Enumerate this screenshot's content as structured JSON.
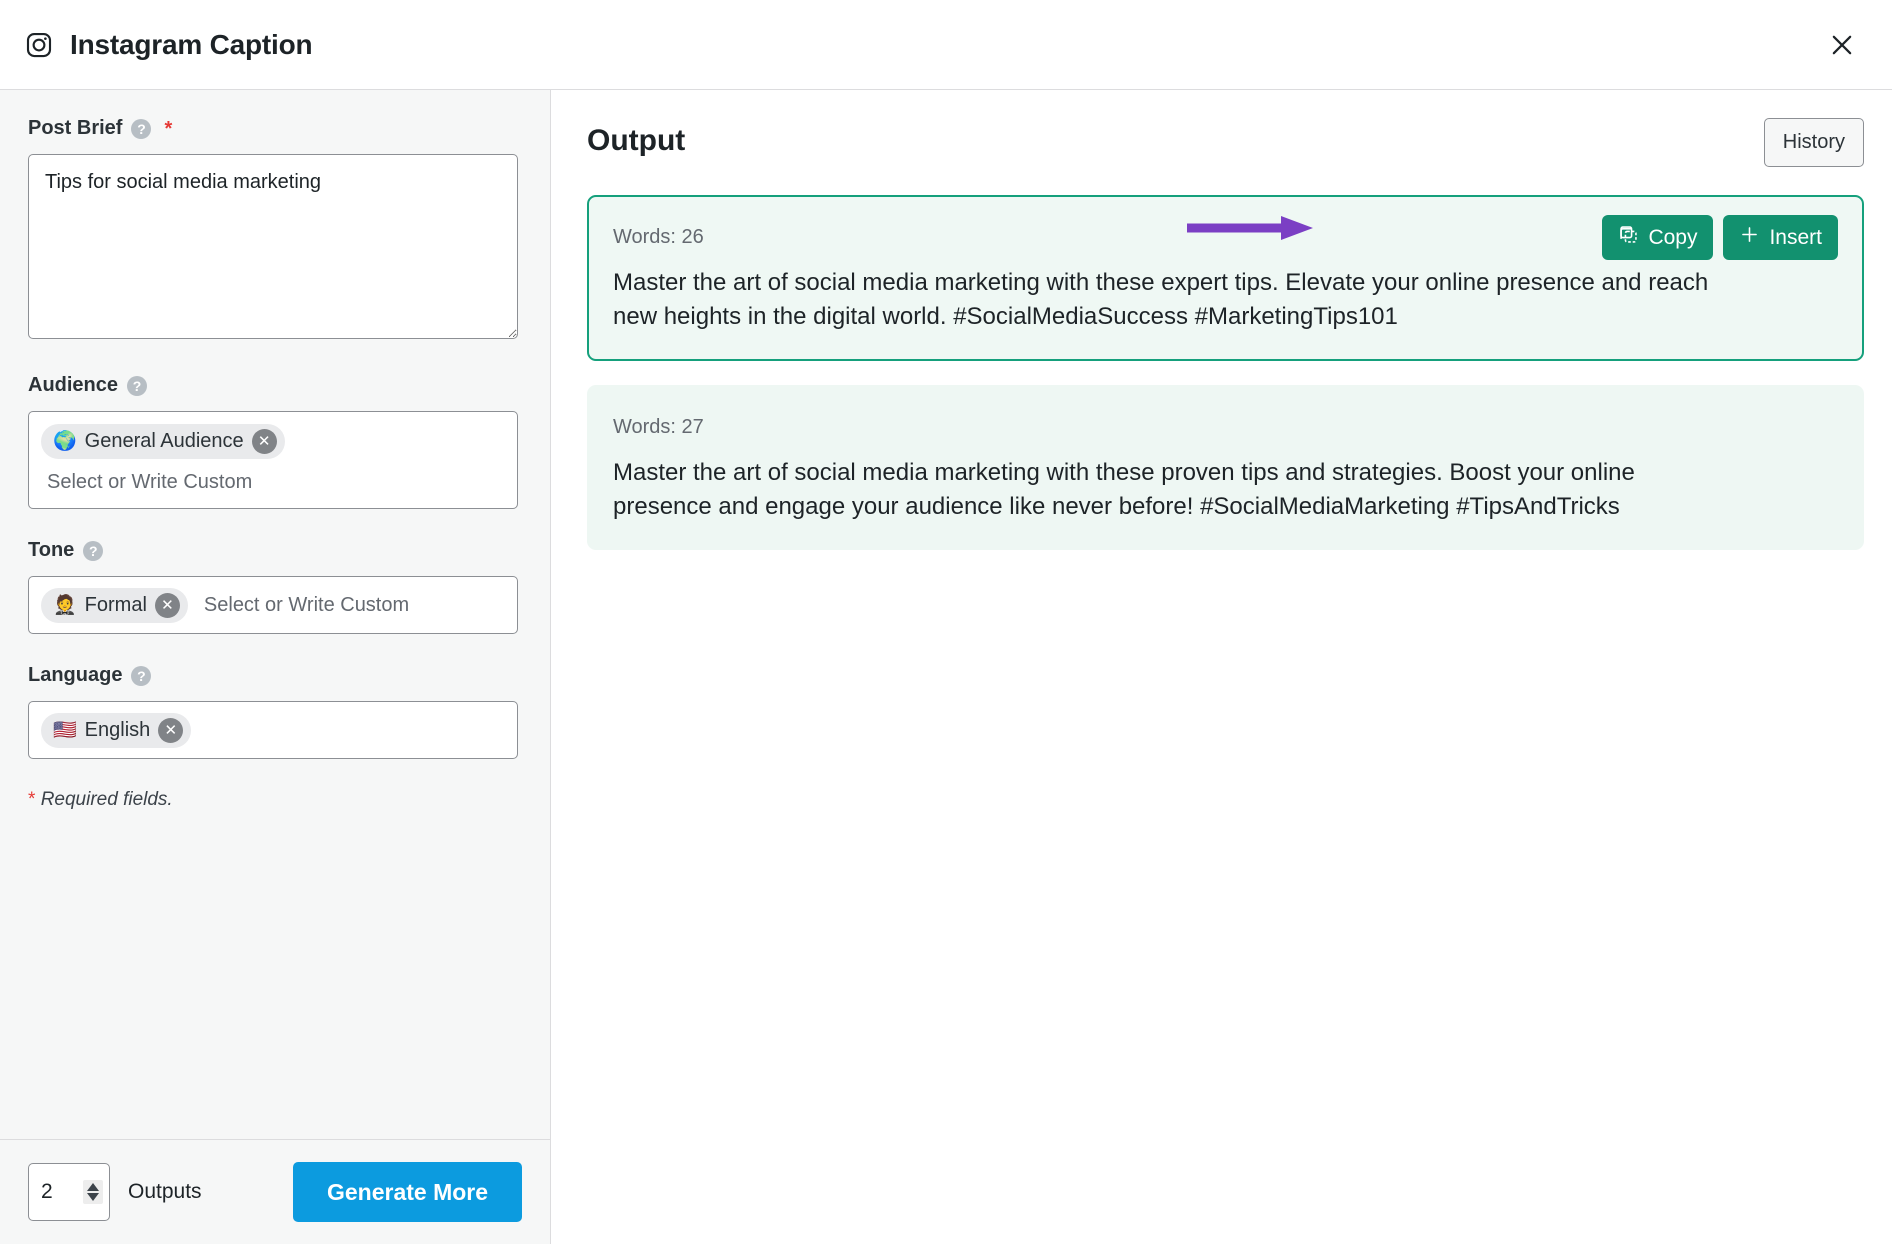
{
  "header": {
    "icon": "instagram-icon",
    "title": "Instagram Caption",
    "close_label": "✕"
  },
  "form": {
    "post_brief": {
      "label": "Post Brief",
      "help": "?",
      "required_marker": "*",
      "value": "Tips for social media marketing",
      "placeholder": ""
    },
    "audience": {
      "label": "Audience",
      "help": "?",
      "chips": [
        {
          "emoji": "🌍",
          "label": "General Audience",
          "remove": "✕"
        }
      ],
      "placeholder": "Select or Write Custom"
    },
    "tone": {
      "label": "Tone",
      "help": "?",
      "chips": [
        {
          "emoji": "🤵",
          "label": "Formal",
          "remove": "✕"
        }
      ],
      "placeholder": "Select or Write Custom"
    },
    "language": {
      "label": "Language",
      "help": "?",
      "chips": [
        {
          "emoji": "🇺🇸",
          "label": "English",
          "remove": "✕"
        }
      ],
      "placeholder": ""
    },
    "required_note_star": "*",
    "required_note": "Required fields."
  },
  "footer": {
    "outputs_count": "2",
    "outputs_label": "Outputs",
    "generate_label": "Generate More"
  },
  "output": {
    "title": "Output",
    "history_label": "History",
    "copy_label": "Copy",
    "insert_label": "Insert",
    "cards": [
      {
        "words": "Words: 26",
        "text": "Master the art of social media marketing with these expert tips. Elevate your online presence and reach new heights in the digital world. #SocialMediaSuccess #MarketingTips101",
        "selected": true
      },
      {
        "words": "Words: 27",
        "text": "Master the art of social media marketing with these proven tips and strategies. Boost your online presence and engage your audience like never before! #SocialMediaMarketing #TipsAndTricks",
        "selected": false
      }
    ]
  },
  "colors": {
    "accent_blue": "#0c9bdf",
    "accent_green": "#12916f",
    "card_border_green": "#15a07c",
    "card_bg": "#eef7f3",
    "annotation_purple": "#7b3fc4",
    "required_red": "#e53935",
    "panel_bg": "#f6f7f7"
  }
}
